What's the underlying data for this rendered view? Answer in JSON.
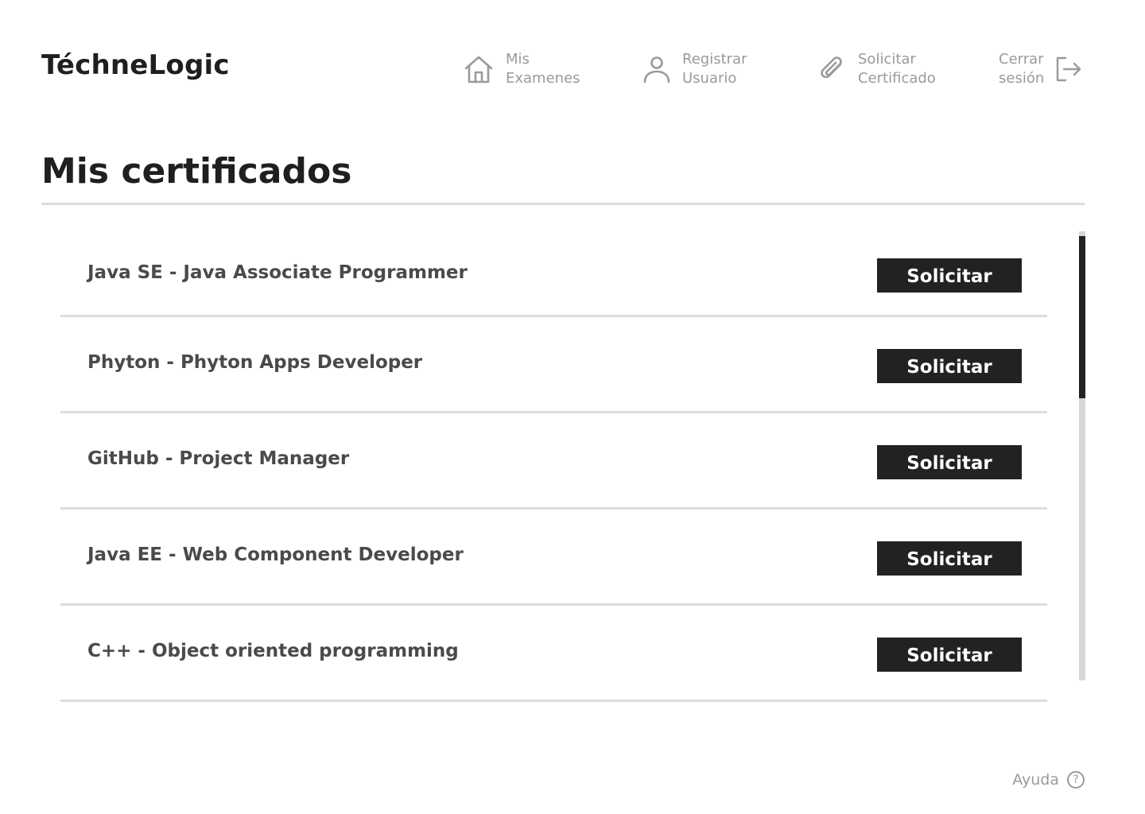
{
  "brand": {
    "name": "TéchneLogic"
  },
  "nav": {
    "items": [
      {
        "line1": "Mis",
        "line2": "Examenes",
        "icon": "home-icon"
      },
      {
        "line1": "Registrar",
        "line2": "Usuario",
        "icon": "user-icon"
      },
      {
        "line1": "Solicitar",
        "line2": "Certificado",
        "icon": "paperclip-icon"
      },
      {
        "line1": "Cerrar",
        "line2": "sesión",
        "icon": "logout-icon"
      }
    ]
  },
  "page": {
    "title": "Mis certificados"
  },
  "certificates": [
    {
      "name": "Java SE - Java Associate Programmer",
      "action": "Solicitar"
    },
    {
      "name": "Phyton - Phyton Apps Developer",
      "action": "Solicitar"
    },
    {
      "name": "GitHub - Project Manager",
      "action": "Solicitar"
    },
    {
      "name": "Java EE - Web Component Developer",
      "action": "Solicitar"
    },
    {
      "name": "C++ - Object oriented programming",
      "action": "Solicitar"
    }
  ],
  "footer": {
    "help_label": "Ayuda",
    "help_icon": "question-circle-icon"
  },
  "colors": {
    "text_primary": "#1f1f1f",
    "text_muted": "#9a9a9a",
    "button_bg": "#222222",
    "divider": "#dcdcdc"
  }
}
